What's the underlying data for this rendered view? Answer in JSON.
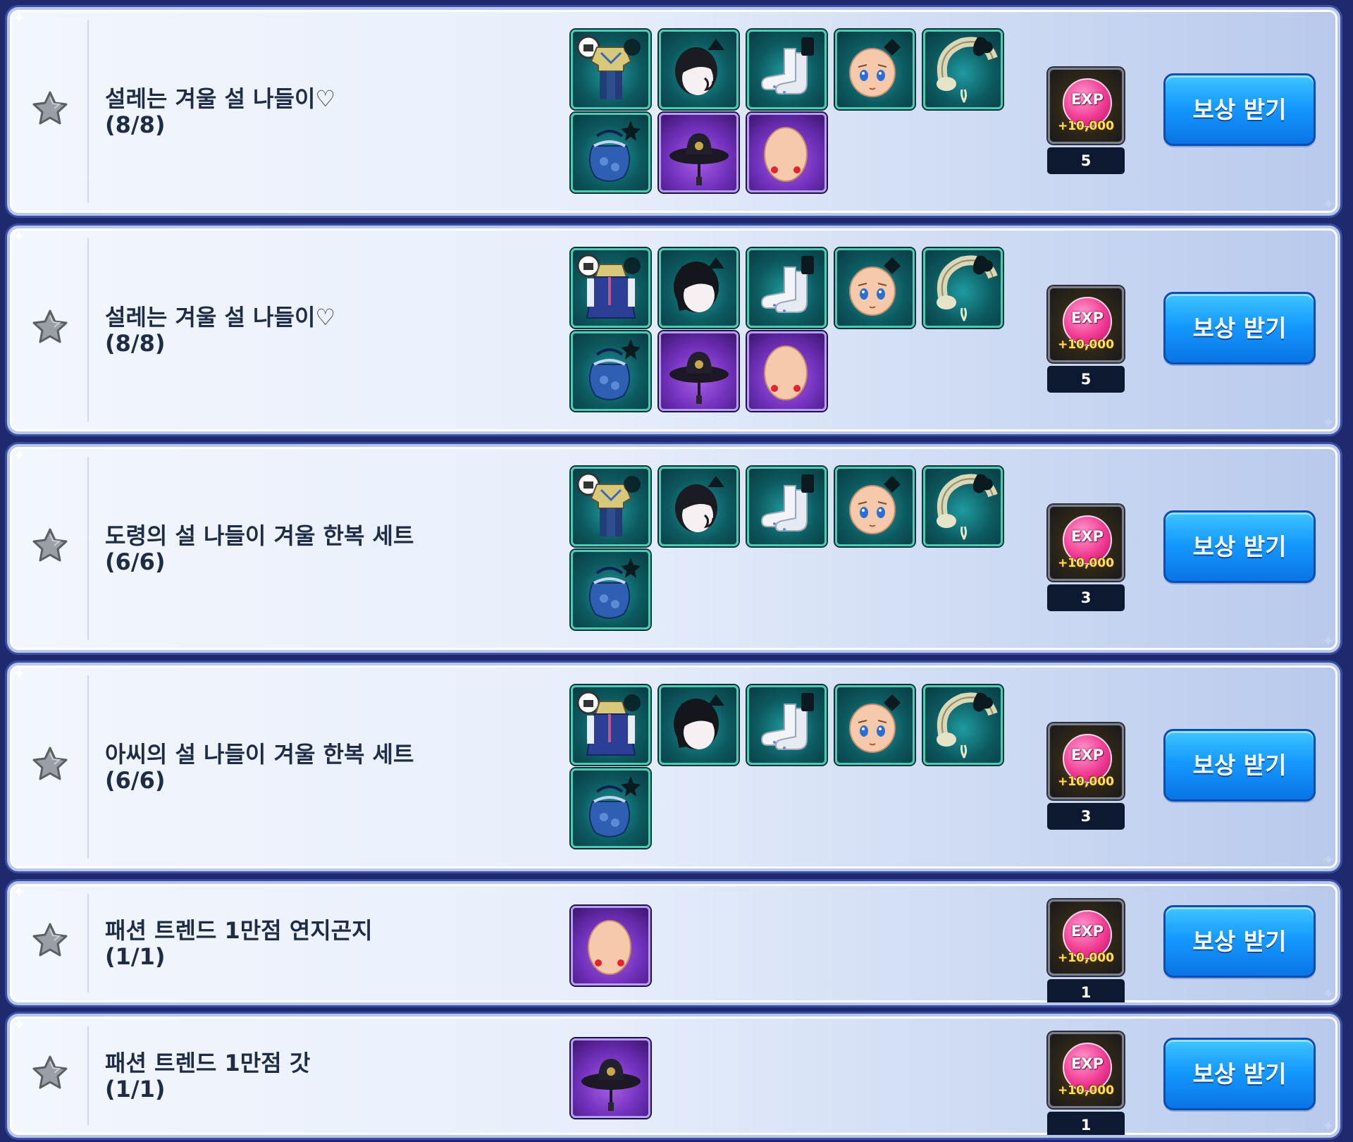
{
  "colors": {
    "row_border": "#b7c7ea",
    "title_text": "#1e2c46",
    "button_blue": "#159aff",
    "teal_frame": "#4ec9b2",
    "purple_frame": "#b69cf3"
  },
  "rows": [
    {
      "title": "설레는 겨울 설 나들이♡",
      "progress": "(8/8)",
      "items": [
        "outfit-hanbok-male",
        "hair-male",
        "socks",
        "face",
        "earmuffs",
        "pouch-bag",
        "gat-hat",
        "blush-face"
      ],
      "reward": {
        "badge": "EXP",
        "amount": "+10,000",
        "count": "5"
      },
      "button_label": "보상 받기"
    },
    {
      "title": "설레는 겨울 설 나들이♡",
      "progress": "(8/8)",
      "items": [
        "outfit-hanbok-female",
        "hair-female",
        "socks",
        "face",
        "earmuffs",
        "pouch-bag",
        "gat-hat",
        "blush-face"
      ],
      "reward": {
        "badge": "EXP",
        "amount": "+10,000",
        "count": "5"
      },
      "button_label": "보상 받기"
    },
    {
      "title": "도령의 설 나들이 겨울 한복 세트",
      "progress": "(6/6)",
      "items": [
        "outfit-hanbok-male",
        "hair-male",
        "socks",
        "face",
        "earmuffs",
        "pouch-bag"
      ],
      "reward": {
        "badge": "EXP",
        "amount": "+10,000",
        "count": "3"
      },
      "button_label": "보상 받기"
    },
    {
      "title": "아씨의 설 나들이 겨울 한복 세트",
      "progress": "(6/6)",
      "items": [
        "outfit-hanbok-female",
        "hair-female",
        "socks",
        "face",
        "earmuffs",
        "pouch-bag"
      ],
      "reward": {
        "badge": "EXP",
        "amount": "+10,000",
        "count": "3"
      },
      "button_label": "보상 받기"
    },
    {
      "title": "패션 트렌드 1만점 연지곤지",
      "progress": "(1/1)",
      "items": [
        "blush-face"
      ],
      "reward": {
        "badge": "EXP",
        "amount": "+10,000",
        "count": "1"
      },
      "button_label": "보상 받기"
    },
    {
      "title": "패션 트렌드 1만점 갓",
      "progress": "(1/1)",
      "items": [
        "gat-hat"
      ],
      "reward": {
        "badge": "EXP",
        "amount": "+10,000",
        "count": "1"
      },
      "button_label": "보상 받기"
    }
  ]
}
